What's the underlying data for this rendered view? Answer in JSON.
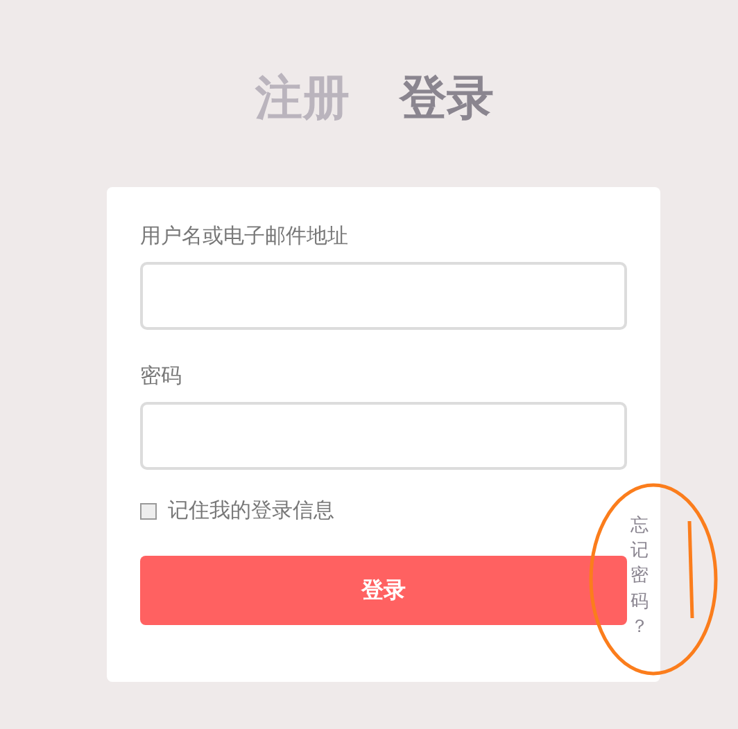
{
  "tabs": [
    {
      "label": "注册",
      "selected": false
    },
    {
      "label": "登录",
      "selected": true
    }
  ],
  "form": {
    "username_label": "用户名或电子邮件地址",
    "password_label": "密码",
    "remember": {
      "label": "记住我的登录信息",
      "checked": false
    },
    "submit": "登录",
    "forgot_link": "忘记密码？"
  }
}
